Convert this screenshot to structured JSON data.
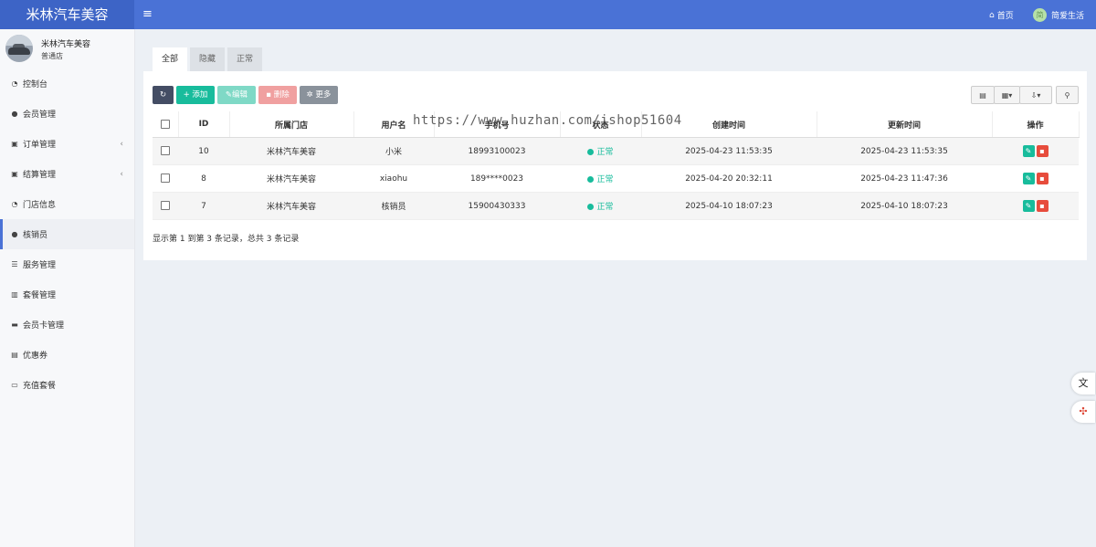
{
  "app": {
    "brand": "米林汽车美容",
    "menu_toggle": "≡"
  },
  "header": {
    "home_label": "首页",
    "user_name": "简爱生活",
    "avatar_text": "简"
  },
  "profile": {
    "name": "米林汽车美容",
    "role": "普通店"
  },
  "sidebar": {
    "items": [
      {
        "label": "控制台",
        "icon": "dashboard-icon",
        "glyph": "◔"
      },
      {
        "label": "会员管理",
        "icon": "user-icon",
        "glyph": "●"
      },
      {
        "label": "订单管理",
        "icon": "shopping-bag-icon",
        "glyph": "▣",
        "arrow": "‹"
      },
      {
        "label": "结算管理",
        "icon": "settlement-icon",
        "glyph": "▣",
        "arrow": "‹"
      },
      {
        "label": "门店信息",
        "icon": "store-icon",
        "glyph": "◔"
      },
      {
        "label": "核销员",
        "icon": "users-icon",
        "glyph": "●",
        "active": true
      },
      {
        "label": "服务管理",
        "icon": "list-icon",
        "glyph": "☰"
      },
      {
        "label": "套餐管理",
        "icon": "gift-icon",
        "glyph": "▥"
      },
      {
        "label": "会员卡管理",
        "icon": "card-icon",
        "glyph": "▬"
      },
      {
        "label": "优惠券",
        "icon": "coupon-icon",
        "glyph": "▤"
      },
      {
        "label": "充值套餐",
        "icon": "money-icon",
        "glyph": "▭"
      }
    ]
  },
  "tabs": [
    "全部",
    "隐藏",
    "正常"
  ],
  "toolbar": {
    "add": "添加",
    "edit": "编辑",
    "delete": "删除",
    "more": "更多"
  },
  "table": {
    "headers": [
      "ID",
      "所属门店",
      "用户名",
      "手机号",
      "状态",
      "创建时间",
      "更新时间",
      "操作"
    ],
    "rows": [
      {
        "id": "10",
        "store": "米林汽车美容",
        "username": "小米",
        "phone": "18993100023",
        "status": "正常",
        "created": "2025-04-23 11:53:35",
        "updated": "2025-04-23 11:53:35"
      },
      {
        "id": "8",
        "store": "米林汽车美容",
        "username": "xiaohu",
        "phone": "189****0023",
        "status": "正常",
        "created": "2025-04-20 20:32:11",
        "updated": "2025-04-23 11:47:36"
      },
      {
        "id": "7",
        "store": "米林汽车美容",
        "username": "核销员",
        "phone": "15900430333",
        "status": "正常",
        "created": "2025-04-10 18:07:23",
        "updated": "2025-04-10 18:07:23"
      }
    ],
    "footer": "显示第 1 到第 3 条记录，总共 3 条记录"
  },
  "watermark": "https://www.huzhan.com/ishop51604",
  "colors": {
    "header": "#4a72d6",
    "success": "#18bc9c",
    "danger": "#e74c3c",
    "dark": "#444d64"
  }
}
